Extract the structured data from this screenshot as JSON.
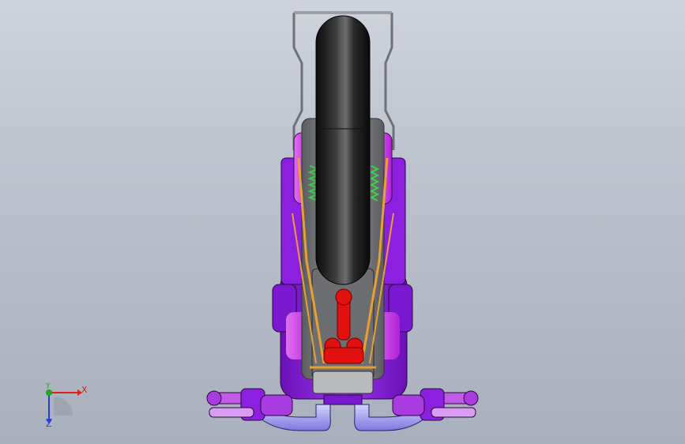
{
  "viewport": {
    "background_top": "#ced3dc",
    "background_bottom": "#a9b0bd"
  },
  "model": {
    "tire_color": "#1a1a1a",
    "frame_color": "#8a8c90",
    "body_purple": "#8c1fe0",
    "body_magenta": "#d73ee8",
    "strut_orange": "#e8a030",
    "engine_red": "#e31010",
    "spring_green": "#3ccf4a",
    "exhaust_lavender": "#a7a3f2"
  },
  "triad": {
    "x_label": "X",
    "y_label": "Y",
    "z_label": "Z",
    "x_color": "#e0201a",
    "y_color": "#1fa51f",
    "z_color": "#2a3fd6"
  }
}
